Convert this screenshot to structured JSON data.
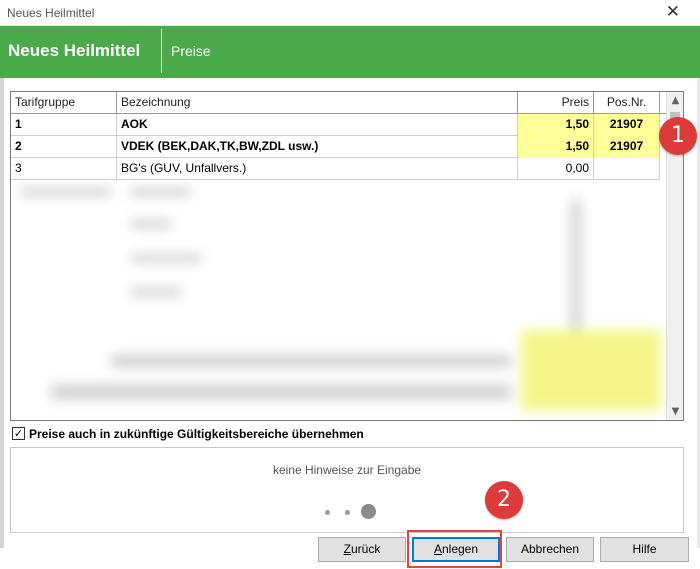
{
  "window": {
    "title": "Neues Heilmittel",
    "close_glyph": "✕"
  },
  "banner": {
    "title": "Neues Heilmittel",
    "subtitle": "Preise",
    "color": "#4aaa4a"
  },
  "table": {
    "columns": [
      "Tarifgruppe",
      "Bezeichnung",
      "Preis",
      "Pos.Nr."
    ],
    "rows": [
      {
        "tarifgruppe": "1",
        "bezeichnung": "AOK",
        "preis": "1,50",
        "posnr": "21907"
      },
      {
        "tarifgruppe": "2",
        "bezeichnung": "VDEK (BEK,DAK,TK,BW,ZDL usw.)",
        "preis": "1,50",
        "posnr": "21907"
      },
      {
        "tarifgruppe": "3",
        "bezeichnung": "BG's (GUV, Unfallvers.)",
        "preis": "0,00",
        "posnr": ""
      }
    ],
    "highlight_color": "#ffff99"
  },
  "checkbox": {
    "label": "Preise auch in zukünftige Gültigkeitsbereiche übernehmen",
    "checked": true,
    "check_glyph": "✓"
  },
  "hint": {
    "text": "keine Hinweise zur Eingabe"
  },
  "pager": {
    "pages": 3,
    "current": 3
  },
  "buttons": {
    "back_mnemonic": "Z",
    "back_rest": "urück",
    "create_mnemonic": "A",
    "create_rest": "nlegen",
    "cancel": "Abbrechen",
    "help": "Hilfe"
  },
  "markers": {
    "m1": "1",
    "m2": "2",
    "color": "#dd3b3b"
  }
}
